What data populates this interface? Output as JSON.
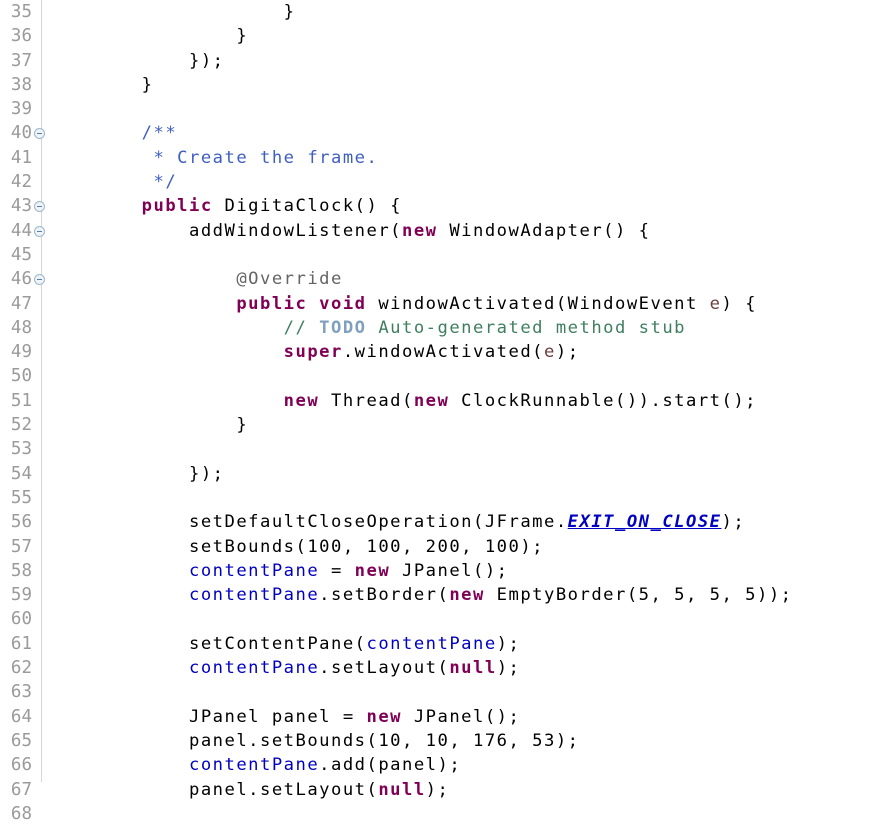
{
  "editor": {
    "app": "eclipse-java-editor",
    "language": "java",
    "class_name": "DigitaClock",
    "first_line": 35,
    "last_line": 68,
    "background": "#ffffff",
    "gutter_separator_color": "#d6d6d6",
    "line_number_color": "#9a9a9a",
    "colors": {
      "keyword": "#7f0055",
      "comment": "#3f7f5f",
      "javadoc": "#3f5fbf",
      "todo_tag": "#7f9fbf",
      "annotation": "#646464",
      "field": "#0000c0",
      "static_field": "#0000c0",
      "parameter": "#6a3e3e",
      "plain": "#000000"
    }
  },
  "lines": [
    {
      "n": 35,
      "fold": false,
      "tokens": [
        {
          "t": "                    }",
          "c": "plain"
        }
      ]
    },
    {
      "n": 36,
      "fold": false,
      "tokens": [
        {
          "t": "                }",
          "c": "plain"
        }
      ]
    },
    {
      "n": 37,
      "fold": false,
      "tokens": [
        {
          "t": "            });",
          "c": "plain"
        }
      ]
    },
    {
      "n": 38,
      "fold": false,
      "tokens": [
        {
          "t": "        }",
          "c": "plain"
        }
      ]
    },
    {
      "n": 39,
      "fold": false,
      "tokens": [
        {
          "t": "",
          "c": "plain"
        }
      ]
    },
    {
      "n": 40,
      "fold": true,
      "tokens": [
        {
          "t": "        /**",
          "c": "jdoc"
        }
      ]
    },
    {
      "n": 41,
      "fold": false,
      "tokens": [
        {
          "t": "         * Create the frame.",
          "c": "jdoc"
        }
      ]
    },
    {
      "n": 42,
      "fold": false,
      "tokens": [
        {
          "t": "         */",
          "c": "jdoc"
        }
      ]
    },
    {
      "n": 43,
      "fold": true,
      "tokens": [
        {
          "t": "        ",
          "c": "plain"
        },
        {
          "t": "public",
          "c": "kw"
        },
        {
          "t": " DigitaClock() {",
          "c": "plain"
        }
      ]
    },
    {
      "n": 44,
      "fold": true,
      "tokens": [
        {
          "t": "            addWindowListener(",
          "c": "plain"
        },
        {
          "t": "new",
          "c": "kw"
        },
        {
          "t": " WindowAdapter() {",
          "c": "plain"
        }
      ]
    },
    {
      "n": 45,
      "fold": false,
      "tokens": [
        {
          "t": "",
          "c": "plain"
        }
      ]
    },
    {
      "n": 46,
      "fold": true,
      "tokens": [
        {
          "t": "                ",
          "c": "plain"
        },
        {
          "t": "@Override",
          "c": "anno"
        }
      ]
    },
    {
      "n": 47,
      "fold": false,
      "tokens": [
        {
          "t": "                ",
          "c": "plain"
        },
        {
          "t": "public",
          "c": "kw"
        },
        {
          "t": " ",
          "c": "plain"
        },
        {
          "t": "void",
          "c": "kw"
        },
        {
          "t": " windowActivated(WindowEvent ",
          "c": "plain"
        },
        {
          "t": "e",
          "c": "param"
        },
        {
          "t": ") {",
          "c": "plain"
        }
      ]
    },
    {
      "n": 48,
      "fold": false,
      "tokens": [
        {
          "t": "                    // ",
          "c": "cmt"
        },
        {
          "t": "TODO",
          "c": "todo"
        },
        {
          "t": " Auto-generated method stub",
          "c": "cmt"
        }
      ]
    },
    {
      "n": 49,
      "fold": false,
      "tokens": [
        {
          "t": "                    ",
          "c": "plain"
        },
        {
          "t": "super",
          "c": "kw"
        },
        {
          "t": ".windowActivated(",
          "c": "plain"
        },
        {
          "t": "e",
          "c": "param"
        },
        {
          "t": ");",
          "c": "plain"
        }
      ]
    },
    {
      "n": 50,
      "fold": false,
      "tokens": [
        {
          "t": "",
          "c": "plain"
        }
      ]
    },
    {
      "n": 51,
      "fold": false,
      "tokens": [
        {
          "t": "                    ",
          "c": "plain"
        },
        {
          "t": "new",
          "c": "kw"
        },
        {
          "t": " Thread(",
          "c": "plain"
        },
        {
          "t": "new",
          "c": "kw"
        },
        {
          "t": " ClockRunnable()).start();",
          "c": "plain"
        }
      ]
    },
    {
      "n": 52,
      "fold": false,
      "tokens": [
        {
          "t": "                }",
          "c": "plain"
        }
      ]
    },
    {
      "n": 53,
      "fold": false,
      "tokens": [
        {
          "t": "",
          "c": "plain"
        }
      ]
    },
    {
      "n": 54,
      "fold": false,
      "tokens": [
        {
          "t": "            });",
          "c": "plain"
        }
      ]
    },
    {
      "n": 55,
      "fold": false,
      "tokens": [
        {
          "t": "",
          "c": "plain"
        }
      ]
    },
    {
      "n": 56,
      "fold": false,
      "tokens": [
        {
          "t": "            setDefaultCloseOperation(JFrame.",
          "c": "plain"
        },
        {
          "t": "EXIT_ON_CLOSE",
          "c": "static"
        },
        {
          "t": ");",
          "c": "plain"
        }
      ]
    },
    {
      "n": 57,
      "fold": false,
      "tokens": [
        {
          "t": "            setBounds(100, 100, 200, 100);",
          "c": "plain"
        }
      ]
    },
    {
      "n": 58,
      "fold": false,
      "tokens": [
        {
          "t": "            ",
          "c": "plain"
        },
        {
          "t": "contentPane",
          "c": "field"
        },
        {
          "t": " = ",
          "c": "plain"
        },
        {
          "t": "new",
          "c": "kw"
        },
        {
          "t": " JPanel();",
          "c": "plain"
        }
      ]
    },
    {
      "n": 59,
      "fold": false,
      "tokens": [
        {
          "t": "            ",
          "c": "plain"
        },
        {
          "t": "contentPane",
          "c": "field"
        },
        {
          "t": ".setBorder(",
          "c": "plain"
        },
        {
          "t": "new",
          "c": "kw"
        },
        {
          "t": " EmptyBorder(5, 5, 5, 5));",
          "c": "plain"
        }
      ]
    },
    {
      "n": 60,
      "fold": false,
      "tokens": [
        {
          "t": "",
          "c": "plain"
        }
      ]
    },
    {
      "n": 61,
      "fold": false,
      "tokens": [
        {
          "t": "            setContentPane(",
          "c": "plain"
        },
        {
          "t": "contentPane",
          "c": "field"
        },
        {
          "t": ");",
          "c": "plain"
        }
      ]
    },
    {
      "n": 62,
      "fold": false,
      "tokens": [
        {
          "t": "            ",
          "c": "plain"
        },
        {
          "t": "contentPane",
          "c": "field"
        },
        {
          "t": ".setLayout(",
          "c": "plain"
        },
        {
          "t": "null",
          "c": "kw"
        },
        {
          "t": ");",
          "c": "plain"
        }
      ]
    },
    {
      "n": 63,
      "fold": false,
      "tokens": [
        {
          "t": "",
          "c": "plain"
        }
      ]
    },
    {
      "n": 64,
      "fold": false,
      "tokens": [
        {
          "t": "            JPanel panel = ",
          "c": "plain"
        },
        {
          "t": "new",
          "c": "kw"
        },
        {
          "t": " JPanel();",
          "c": "plain"
        }
      ]
    },
    {
      "n": 65,
      "fold": false,
      "tokens": [
        {
          "t": "            panel.setBounds(10, 10, 176, 53);",
          "c": "plain"
        }
      ]
    },
    {
      "n": 66,
      "fold": false,
      "tokens": [
        {
          "t": "            ",
          "c": "plain"
        },
        {
          "t": "contentPane",
          "c": "field"
        },
        {
          "t": ".add(panel);",
          "c": "plain"
        }
      ]
    },
    {
      "n": 67,
      "fold": false,
      "tokens": [
        {
          "t": "            panel.setLayout(",
          "c": "plain"
        },
        {
          "t": "null",
          "c": "kw"
        },
        {
          "t": ");",
          "c": "plain"
        }
      ]
    },
    {
      "n": 68,
      "fold": false,
      "tokens": [
        {
          "t": "",
          "c": "plain"
        }
      ]
    }
  ]
}
